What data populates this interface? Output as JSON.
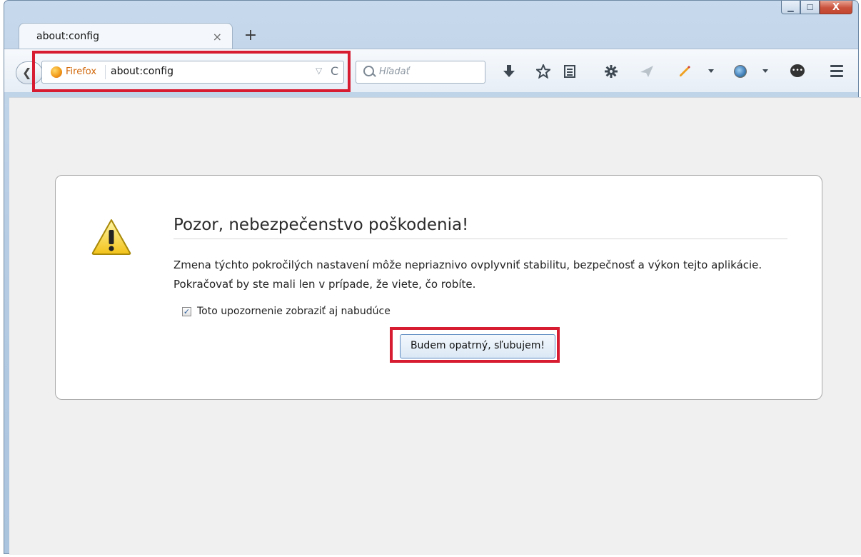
{
  "window": {
    "minimize_glyph": "▁",
    "maximize_glyph": "☐",
    "close_glyph": "X"
  },
  "tab": {
    "title": "about:config",
    "close_glyph": "×",
    "new_tab_glyph": "+"
  },
  "navbar": {
    "back_glyph": "❮",
    "identity": "Firefox",
    "url": "about:config",
    "url_dropdown_glyph": "▽",
    "reload_glyph": "C",
    "search_placeholder": "Hľadať",
    "icons": [
      "download-icon",
      "bookmark-star-icon",
      "bookmarks-menu-icon",
      "addons-icon",
      "send-icon",
      "pencil-icon",
      "globe-icon",
      "chat-icon",
      "menu-icon"
    ]
  },
  "warning": {
    "title": "Pozor, nebezpečenstvo poškodenia!",
    "text": "Zmena týchto pokročilých nastavení môže nepriaznivo ovplyvniť stabilitu, bezpečnosť a výkon tejto aplikácie. Pokračovať by ste mali len v prípade, že viete, čo robíte.",
    "checkbox_label": "Toto upozornenie zobraziť aj nabudúce",
    "checkbox_checked": true,
    "button_label": "Budem opatrný, sľubujem!"
  },
  "colors": {
    "highlight": "#d71b30",
    "identity": "#d2690c"
  }
}
